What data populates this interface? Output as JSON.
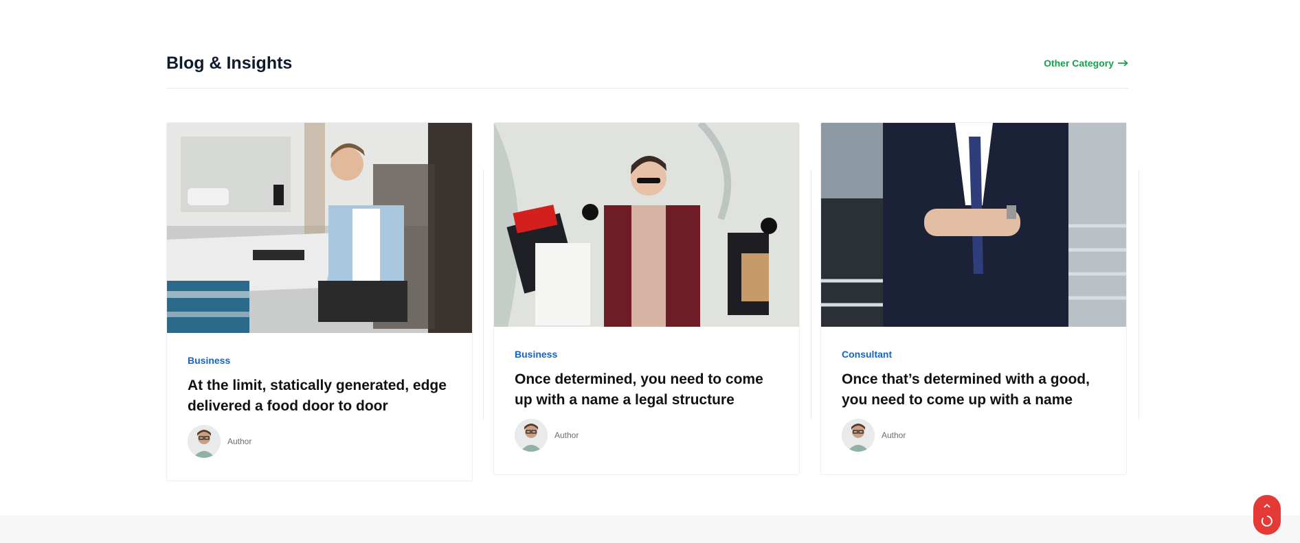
{
  "section": {
    "title": "Blog & Insights",
    "other_link": "Other Category"
  },
  "posts": [
    {
      "category": "Business",
      "title": "At the limit, statically generated, edge delivered a food door to door",
      "author": "Author"
    },
    {
      "category": "Business",
      "title": "Once determined, you need to come up with a name a legal structure",
      "author": "Author"
    },
    {
      "category": "Consultant",
      "title": "Once that’s determined with a good, you need to come up with a name",
      "author": "Author"
    }
  ],
  "icons": {
    "arrow": "arrow-right-icon",
    "scroll": "chevron-up-icon"
  },
  "colors": {
    "accent_green": "#1a9e4a",
    "category_blue": "#1565c0",
    "scroll_button": "#e53935"
  }
}
